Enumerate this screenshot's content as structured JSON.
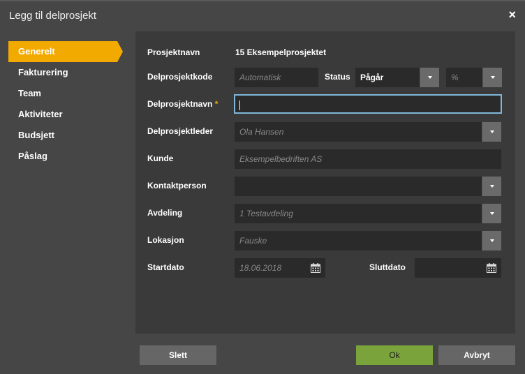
{
  "dialog": {
    "title": "Legg til delprosjekt",
    "close": "×"
  },
  "sidebar": {
    "items": [
      {
        "label": "Generelt",
        "active": true
      },
      {
        "label": "Fakturering"
      },
      {
        "label": "Team"
      },
      {
        "label": "Aktiviteter"
      },
      {
        "label": "Budsjett"
      },
      {
        "label": "Påslag"
      }
    ]
  },
  "form": {
    "prosjektnavn": {
      "label": "Prosjektnavn",
      "value": "15 Eksempelprosjektet"
    },
    "delprosjektkode": {
      "label": "Delprosjektkode",
      "placeholder": "Automatisk"
    },
    "status": {
      "label": "Status",
      "value": "Pågår",
      "percent_placeholder": "%"
    },
    "delprosjektnavn": {
      "label": "Delprosjektnavn",
      "required": "*",
      "value": ""
    },
    "delprosjektleder": {
      "label": "Delprosjektleder",
      "placeholder": "Ola Hansen"
    },
    "kunde": {
      "label": "Kunde",
      "placeholder": "Eksempelbedriften AS"
    },
    "kontaktperson": {
      "label": "Kontaktperson",
      "value": ""
    },
    "avdeling": {
      "label": "Avdeling",
      "placeholder": "1 Testavdeling"
    },
    "lokasjon": {
      "label": "Lokasjon",
      "placeholder": "Fauske"
    },
    "startdato": {
      "label": "Startdato",
      "placeholder": "18.06.2018"
    },
    "sluttdato": {
      "label": "Sluttdato",
      "value": ""
    }
  },
  "buttons": {
    "delete": "Slett",
    "ok": "Ok",
    "cancel": "Avbryt"
  },
  "colors": {
    "accent": "#f2a900",
    "ok": "#7aa33c",
    "focus": "#7fb8d8"
  },
  "icons": {
    "close": "close-icon",
    "dropdown": "chevron-down-icon",
    "calendar": "calendar-icon"
  }
}
